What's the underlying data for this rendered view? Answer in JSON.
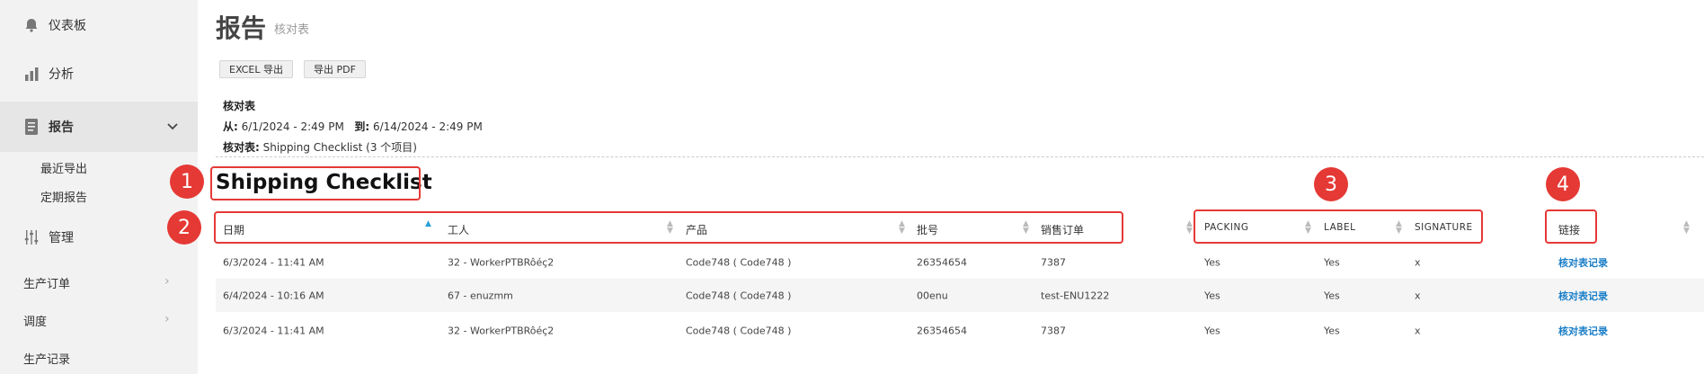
{
  "sidebar": {
    "items": [
      {
        "label": "仪表板",
        "icon": "bell-icon"
      },
      {
        "label": "分析",
        "icon": "bar-chart-icon"
      },
      {
        "label": "报告",
        "icon": "report-icon"
      },
      {
        "label": "管理",
        "icon": "sliders-icon"
      }
    ],
    "sub_items": [
      "最近导出",
      "定期报告"
    ],
    "plain_items": [
      "生产订单",
      "调度",
      "生产记录"
    ]
  },
  "header": {
    "title": "报告",
    "subtitle": "核对表"
  },
  "toolbar": {
    "excel_label": "EXCEL 导出",
    "pdf_label": "导出 PDF"
  },
  "meta": {
    "heading": "核对表",
    "from_label": "从:",
    "from_value": "6/1/2024 - 2:49 PM",
    "to_label": "到:",
    "to_value": "6/14/2024 - 2:49 PM",
    "checklist_label": "核对表:",
    "checklist_value": "Shipping Checklist (3 个项目)"
  },
  "checklist_title": "Shipping Checklist",
  "table": {
    "columns": [
      "日期",
      "工人",
      "产品",
      "批号",
      "销售订单",
      "PACKING",
      "LABEL",
      "SIGNATURE",
      "链接"
    ],
    "rows": [
      [
        "6/3/2024 - 11:41 AM",
        "32 - WorkerPTBRôéç2",
        "Code748 ( Code748 )",
        "26354654",
        "7387",
        "Yes",
        "Yes",
        "x",
        "核对表记录"
      ],
      [
        "6/4/2024 - 10:16 AM",
        "67 - enuzmm",
        "Code748 ( Code748 )",
        "00enu",
        "test-ENU1222",
        "Yes",
        "Yes",
        "x",
        "核对表记录"
      ],
      [
        "6/3/2024 - 11:41 AM",
        "32 - WorkerPTBRôéç2",
        "Code748 ( Code748 )",
        "26354654",
        "7387",
        "Yes",
        "Yes",
        "x",
        "核对表记录"
      ]
    ]
  },
  "annotations": [
    "1",
    "2",
    "3",
    "4"
  ],
  "colors": {
    "accent": "#e53935",
    "link": "#1a7ec8",
    "sort_active": "#2a9fd6"
  }
}
